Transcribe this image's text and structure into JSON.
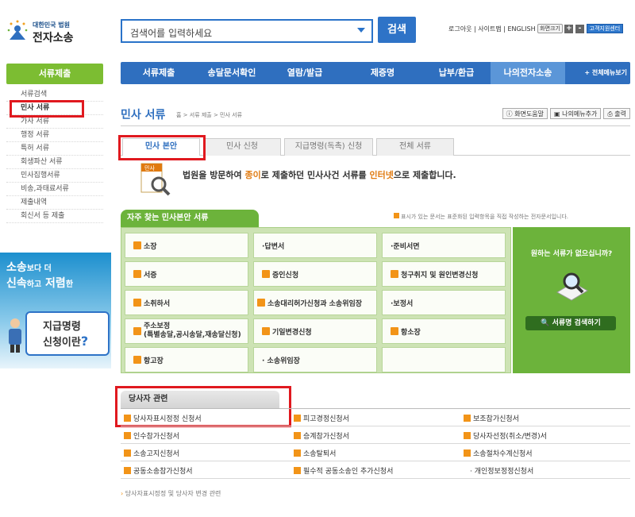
{
  "header": {
    "logo_small": "대한민국 법원",
    "logo_big": "전자소송",
    "search_placeholder": "검색어를 입력하세요",
    "search_button": "검색",
    "util_links": "로그아웃 | 사이트맵 | ENGLISH",
    "size_label": "화면크기",
    "plus": "+",
    "minus": "-",
    "customer_center": "고객지원센터"
  },
  "left_nav": {
    "title": "서류제출",
    "items": [
      "서류검색",
      "민사 서류",
      "가사 서류",
      "행정 서류",
      "특허 서류",
      "회생파산 서류",
      "민사집행서류",
      "비송,과태료서류",
      "제출내역",
      "회신서 등 제출"
    ]
  },
  "banner": {
    "line1_a": "소송",
    "line1_b": "보다 더",
    "line2_a": "신속",
    "line2_b": "하고",
    "line2_c": "저렴",
    "line2_d": "한",
    "bubble1": "지급명령",
    "bubble2": "신청이란",
    "q": "?"
  },
  "global_nav": {
    "items": [
      "서류제출",
      "송달문서확인",
      "열람/발급",
      "제증명",
      "납부/환급",
      "나의전자소송"
    ],
    "all_menu": "+ 전체메뉴보기"
  },
  "page": {
    "title": "민사 서류",
    "breadcrumb": "홈 > 서류 제출 > 민사 서류",
    "tools": [
      "화면도움말",
      "나의메뉴추가",
      "출력"
    ]
  },
  "tabs": [
    "민사 본안",
    "민사 신청",
    "지급명령(독촉) 신청",
    "전체 서류"
  ],
  "intro": {
    "icon_label": "민사",
    "text_a": "법원을 방문하여 ",
    "text_b": "종이",
    "text_c": "로 제출하던 민사사건 서류를 ",
    "text_d": "인터넷",
    "text_e": "으로 제출합니다."
  },
  "frequent": {
    "title": "자주 찾는 민사본안 서류",
    "note": "표시가 있는 문서는 표준화된 입력항목을 직접 작성하는 전자문서입니다.",
    "rows": [
      [
        "소장",
        "·답변서",
        "·준비서면"
      ],
      [
        "서증",
        "증인신청",
        "청구취지 및 원인변경신청"
      ],
      [
        "소취하서",
        "소송대리허가신청과 소송위임장",
        "·보정서"
      ],
      [
        "주소보정",
        "기일변경신청",
        "항소장"
      ],
      [
        "항고장",
        "· 소송위임장",
        ""
      ]
    ],
    "address_sub": "(특별송달,공시송달,재송달신청)",
    "side_question": "원하는 서류가 없으십니까?",
    "side_button": "서류명 검색하기"
  },
  "party": {
    "title": "당사자 관련",
    "rows": [
      [
        "당사자표시정정 신청서",
        "피고경정신청서",
        "보조참가신청서"
      ],
      [
        "인수참가신청서",
        "승계참가신청서",
        "당사자선정(취소/변경)서"
      ],
      [
        "소송고지신청서",
        "소송탈퇴서",
        "소송절차수계신청서"
      ],
      [
        "공동소송참가신청서",
        "필수적 공동소송인 추가신청서",
        "· 개인정보정정신청서"
      ]
    ],
    "footer": "당사자표시정정 및 당사자 변경 관련"
  }
}
